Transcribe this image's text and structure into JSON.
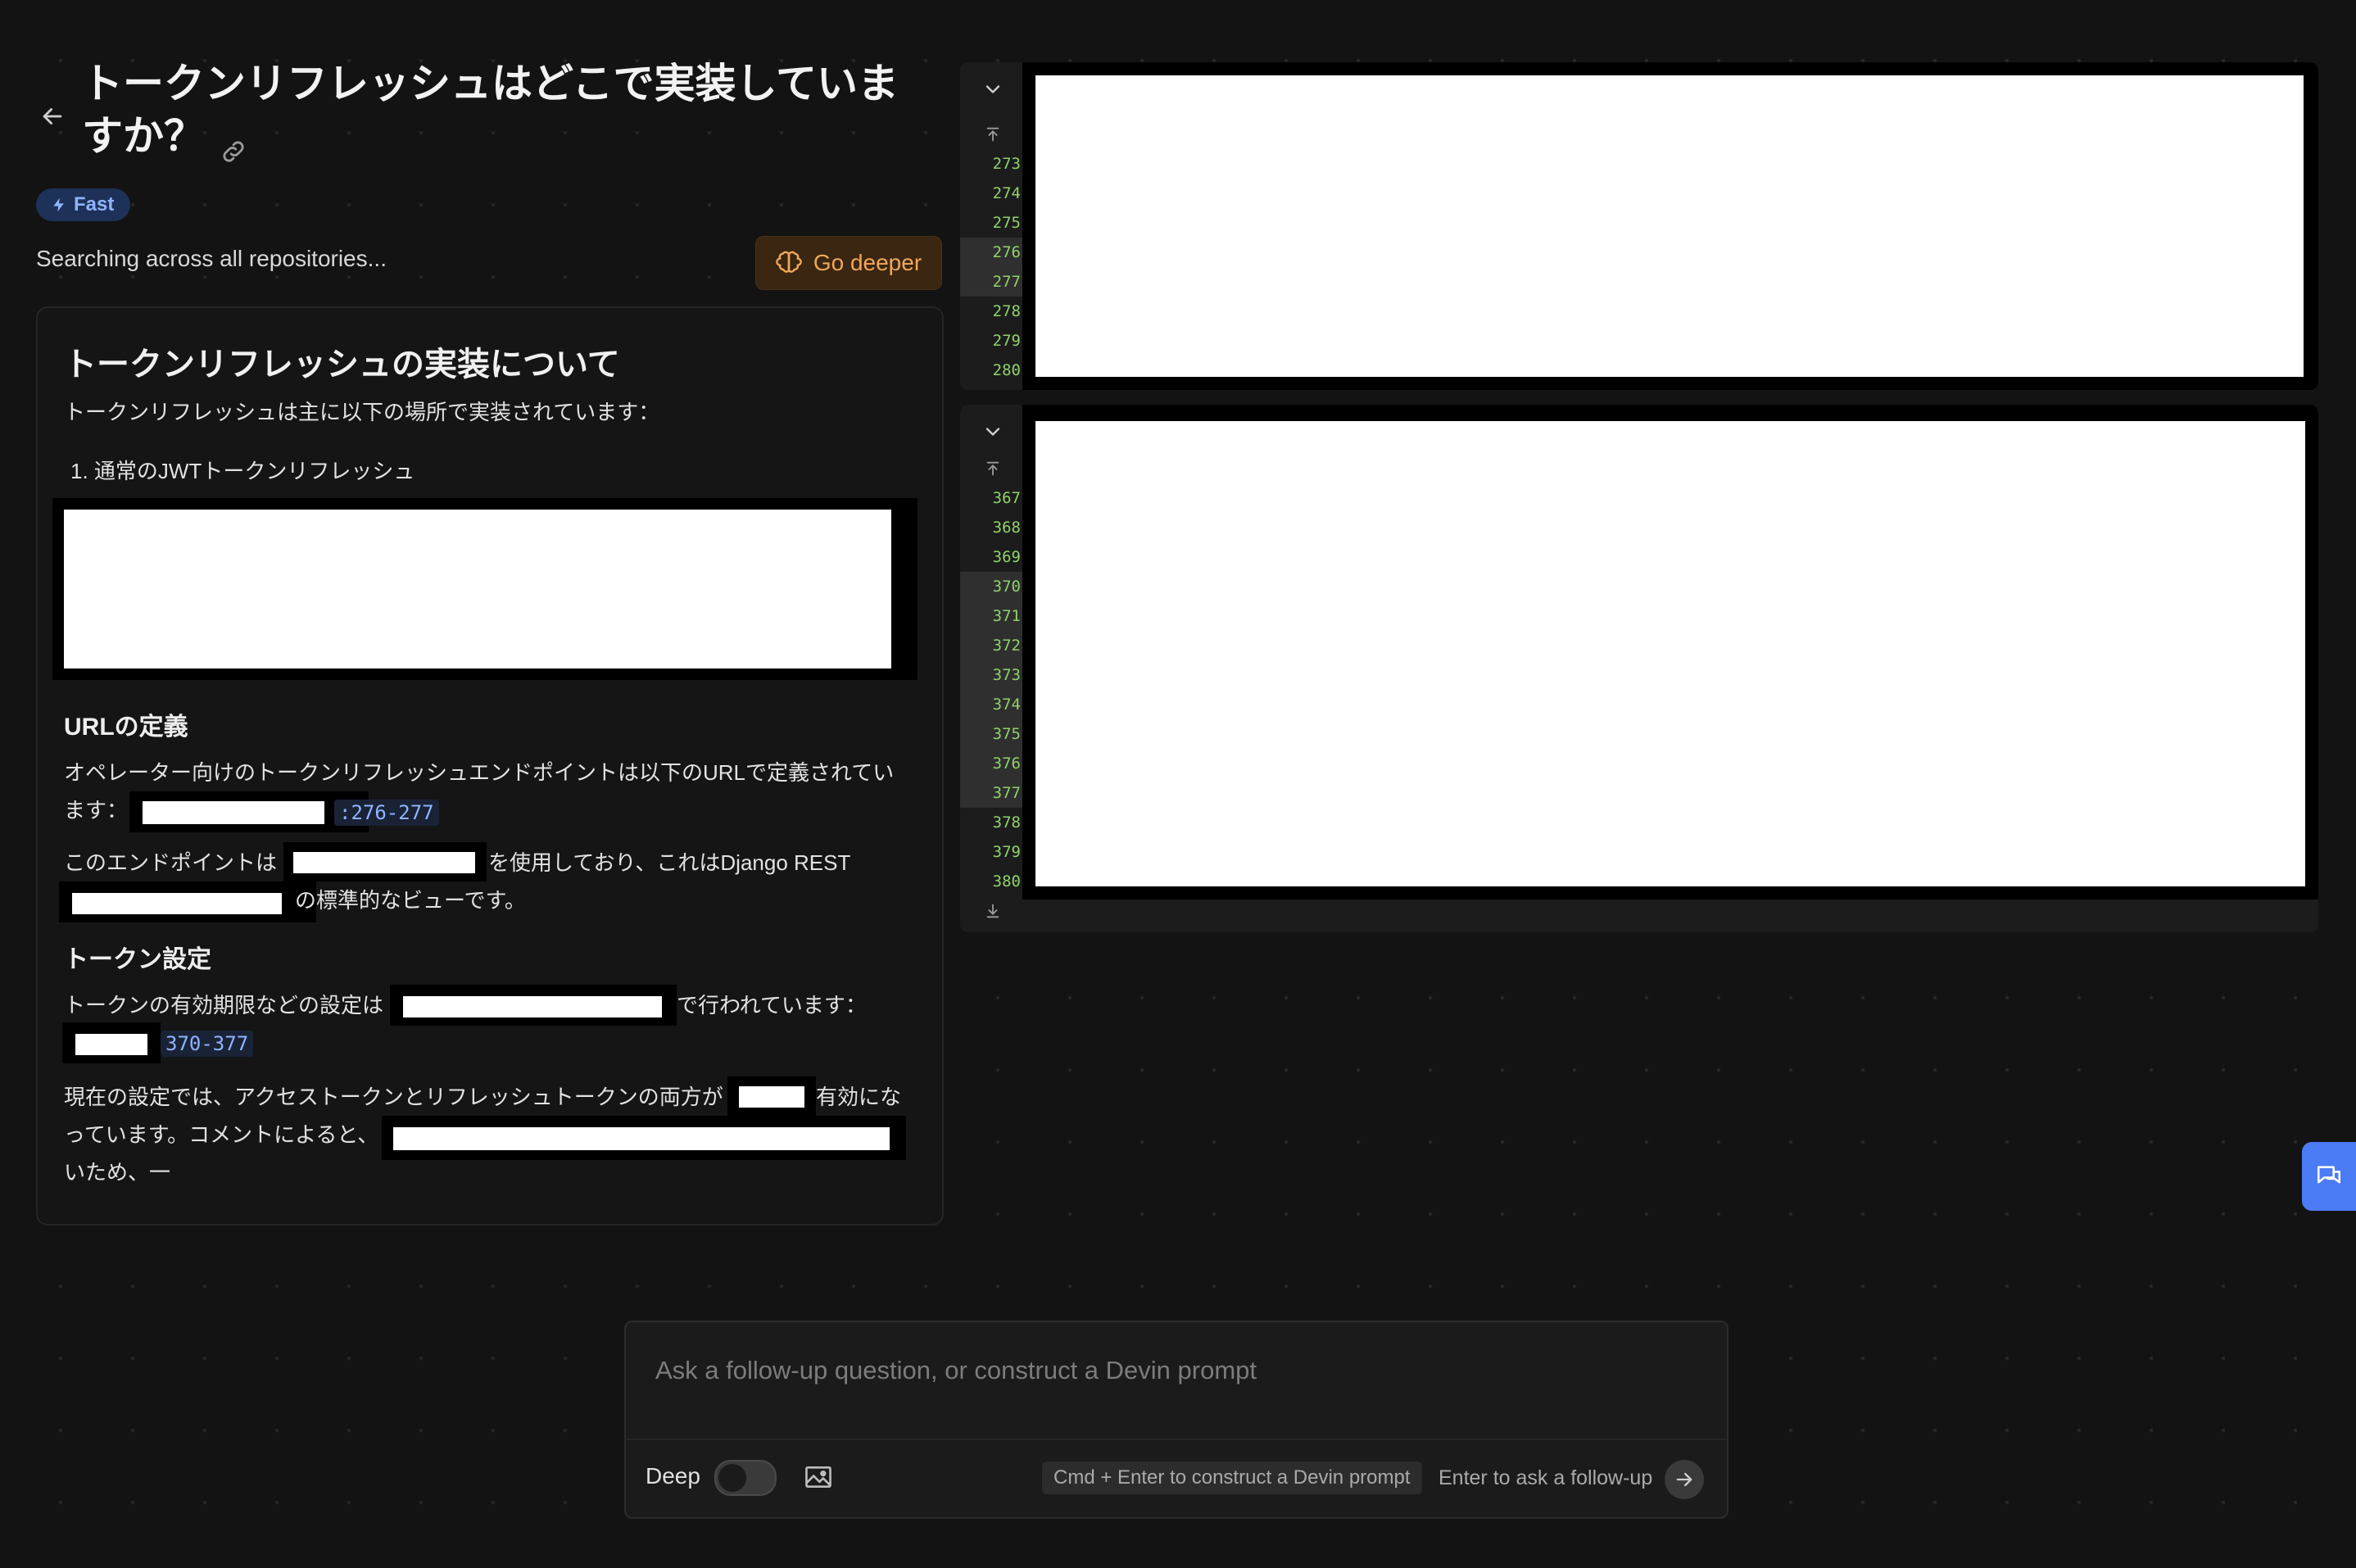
{
  "header": {
    "title": "トークンリフレッシュはどこで実装していますか？",
    "badge": "Fast",
    "status": "Searching across all repositories...",
    "go_deeper": "Go deeper"
  },
  "answer": {
    "heading": "トークンリフレッシュの実装について",
    "intro": "トークンリフレッシュは主に以下の場所で実装されています：",
    "list_item_1": "1.  通常のJWTトークンリフレッシュ",
    "url_heading": "URLの定義",
    "url_text_1": "オペレーター向けのトークンリフレッシュエンドポイントは以下のURLで定義されてい",
    "url_text_2": "ます：",
    "url_ref": ":276-277",
    "endpoint_text_1": "このエンドポイントは",
    "endpoint_text_2": "を使用しており、これはDjango REST",
    "endpoint_text_3": "の標準的なビューです。",
    "token_heading": "トークン設定",
    "token_text_1": "トークンの有効期限などの設定は",
    "token_text_2": "で行われています：",
    "token_ref": "370-377",
    "current_text_1": "現在の設定では、アクセストークンとリフレッシュトークンの両方が",
    "current_text_2": "有効にな",
    "current_text_3": "っています。コメントによると、",
    "current_text_4": "いため、一"
  },
  "code_panels": [
    {
      "lines": [
        "273",
        "274",
        "275",
        "276",
        "277",
        "278",
        "279",
        "280"
      ],
      "highlighted": [
        "276",
        "277"
      ]
    },
    {
      "lines": [
        "367",
        "368",
        "369",
        "370",
        "371",
        "372",
        "373",
        "374",
        "375",
        "376",
        "377",
        "378",
        "379",
        "380"
      ],
      "highlighted": [
        "370",
        "371",
        "372",
        "373",
        "374",
        "375",
        "376",
        "377"
      ]
    }
  ],
  "input": {
    "placeholder": "Ask a follow-up question, or construct a Devin prompt",
    "deep_label": "Deep",
    "cmd_hint": "Cmd + Enter to construct a Devin prompt",
    "enter_hint": "Enter to ask a follow-up"
  },
  "colors": {
    "background": "#131313",
    "accent_blue": "#8fb4ff",
    "go_deeper_text": "#f0a75a",
    "line_number": "#8fd16a",
    "chat_fab": "#4b7bf5"
  }
}
